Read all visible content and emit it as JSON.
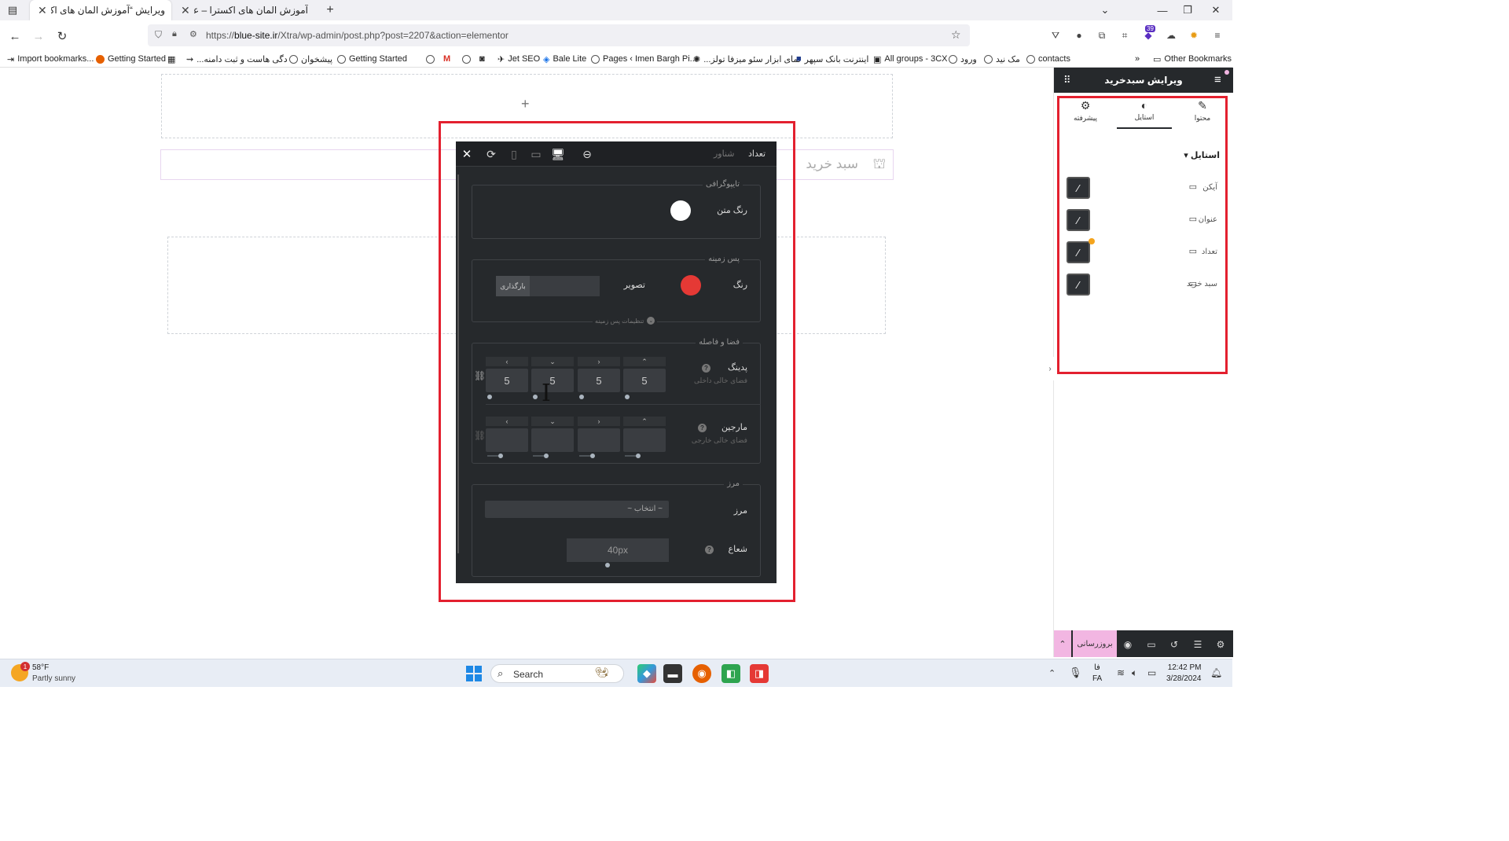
{
  "browser": {
    "tabs": [
      {
        "label": "ویرایش “آموزش المان های اکسترا – ...",
        "active": true
      },
      {
        "label": "آموزش المان های اکسترا – علاءالدین",
        "active": false
      }
    ],
    "url_prefix": "https://",
    "url_domain": "blue-site.ir",
    "url_path": "/Xtra/wp-admin/post.php?post=2207&action=elementor",
    "notification_count": "39",
    "bookmarks": [
      "Import bookmarks...",
      "Getting Started",
      "...دگی هاست و ثبت دامنه",
      "پیشخوان",
      "Getting Started",
      "Jet SEO",
      "Bale Lite",
      "Pages ‹ Imen Bargh Pi...",
      "...نمای ابزار سئو میزفا تولز",
      "اینترنت بانک سپهر",
      "All groups - 3CX",
      "ورود",
      "مک نید",
      "contacts"
    ],
    "other_bookmarks": "Other Bookmarks"
  },
  "canvas": {
    "add_symbol": "+",
    "cart_label": "سبد خرید"
  },
  "popup": {
    "header_title": "تعداد",
    "header_sub": "شناور",
    "typography": {
      "section_title": "تایپوگرافی",
      "text_color_label": "رنگ متن",
      "text_color": "#ffffff"
    },
    "background": {
      "section_title": "پس زمینه",
      "color_label": "رنگ",
      "color": "#e53935",
      "image_label": "تصویر",
      "upload_label": "بارگذاری",
      "settings_toggle": "تنظیمات پس زمینه"
    },
    "spacing": {
      "section_title": "فضا و فاصله",
      "padding_label": "پدینگ",
      "padding_sub": "فضای خالی داخلی",
      "padding_values": [
        "5",
        "5",
        "5",
        "5"
      ],
      "margin_label": "مارجین",
      "margin_sub": "فضای خالی خارجی",
      "margin_values": [
        "",
        "",
        "",
        ""
      ]
    },
    "border": {
      "section_title": "مرز",
      "border_label": "مرز",
      "border_select": "~ انتخاب ~",
      "radius_label": "شعاع",
      "radius_value": "40px"
    }
  },
  "panel": {
    "title": "ویرایش سبدخرید",
    "tabs": [
      "محتوا",
      "استایل",
      "پیشرفته"
    ],
    "style_section": "استایل",
    "style_rows": [
      "آیکن",
      "عنوان",
      "تعداد",
      "سبد خرید"
    ],
    "update_button": "بروزرسانی"
  },
  "taskbar": {
    "weather_temp": "58°F",
    "weather_desc": "Partly sunny",
    "weather_badge": "1",
    "search_label": "Search",
    "lang_top": "فا",
    "lang_bottom": "FA",
    "time": "12:42 PM",
    "date": "3/28/2024"
  }
}
